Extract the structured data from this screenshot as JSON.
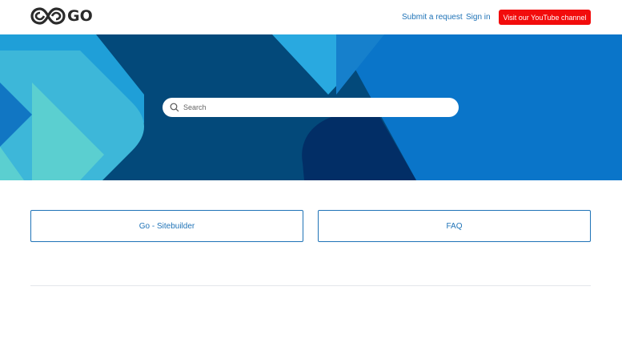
{
  "header": {
    "logo_text": "GO",
    "submit_request": "Submit a request",
    "sign_in": "Sign in",
    "youtube_button": "Visit our YouTube channel"
  },
  "search": {
    "placeholder": "Search"
  },
  "categories": [
    {
      "label": "Go - Sitebuilder"
    },
    {
      "label": "FAQ"
    }
  ],
  "colors": {
    "link": "#1f73b7",
    "youtube_red": "#f20c0c",
    "hero_dark": "#03497a",
    "hero_blue": "#0a75c9",
    "hero_light": "#29a9e0",
    "hero_teal": "#4cc6d1"
  }
}
